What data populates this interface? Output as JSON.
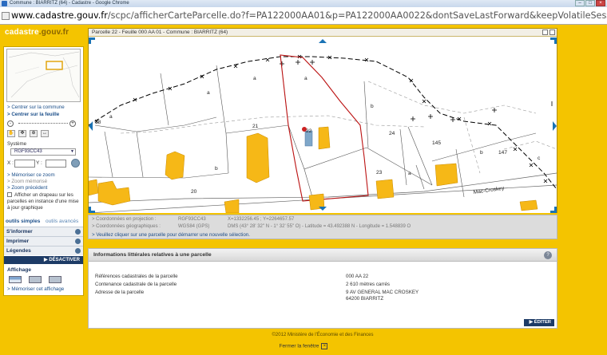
{
  "browser": {
    "window_title": "Commune : BIARRITZ (64) - Cadastre - Google Chrome",
    "url_host": "www.cadastre.gouv.fr",
    "url_path": "/scpc/afficherCarteParcelle.do?f=PA122000AA01&p=PA122000AA0022&dontSaveLastForward&keepVolatileSession="
  },
  "logo": {
    "text": "cadastre",
    "suffix": ".gouv.fr"
  },
  "left_panel": {
    "link_center_commune": "> Centrer sur la commune",
    "link_center_feuille": "> Centrer sur la feuille",
    "system_label": "Système",
    "system_value": "RGF93CC43",
    "x_label": "X :",
    "y_label": "Y :",
    "link_memorize_zoom": "> Mémoriser ce zoom",
    "zoom_memorized": "> Zoom mémorisé",
    "link_previous_zoom": "> Zoom précédent",
    "flag_text_1": "Afficher un drapeau sur les",
    "flag_text_2": "parcelles en instance d'une mise",
    "flag_text_3": "à jour graphique",
    "tab_simple": "outils simples",
    "tab_advanced": "outils avancés",
    "menu": [
      "S'informer",
      "Imprimer",
      "Légendes"
    ],
    "desactivate": "DÉSACTIVER",
    "display_title": "Affichage",
    "link_memorize_display": "> Mémoriser cet affichage"
  },
  "map": {
    "header": "Parcelle 22 - Feuille 000 AA 01 - Commune : BIARRITZ (64)",
    "labels": {
      "p18": "18",
      "p21": "21",
      "p22": "22",
      "p24": "24",
      "p23": "23",
      "p20": "20",
      "p145": "145",
      "p147": "147",
      "a": "a",
      "b": "b",
      "c": "c",
      "street": "Mac-Croskey"
    }
  },
  "coords": {
    "proj_label": "> Coordonnées en projection :",
    "proj_system": "RGF93CC43",
    "proj_value": "X=1332256.45 ; Y=2264657.57",
    "geo_label": "> Coordonnées géographiques :",
    "geo_system": "WGS84 (GPS)",
    "geo_value": "DMS (43° 28' 32\" N - 1° 32' 55\" O) - Latitude = 43.492388 N - Longitude = 1.548839 O",
    "message": "> Veuillez cliquer sur une parcelle pour démarrer une nouvelle sélection."
  },
  "info": {
    "title": "Informations littérales relatives à une parcelle",
    "ref_label": "Références cadastrales de la parcelle",
    "ref_value": "000 AA 22",
    "area_label": "Contenance cadastrale de la parcelle",
    "area_value": "2 610 mètres carrés",
    "addr_label": "Adresse de la parcelle",
    "addr_line1": "9 AV GENERAL MAC CROSKEY",
    "addr_line2": "64200 BIARRITZ",
    "edit_label": "ÉDITER"
  },
  "footer": "©2012 Ministère de l'Économie et des Finances",
  "close_window": "Fermer la fenêtre"
}
